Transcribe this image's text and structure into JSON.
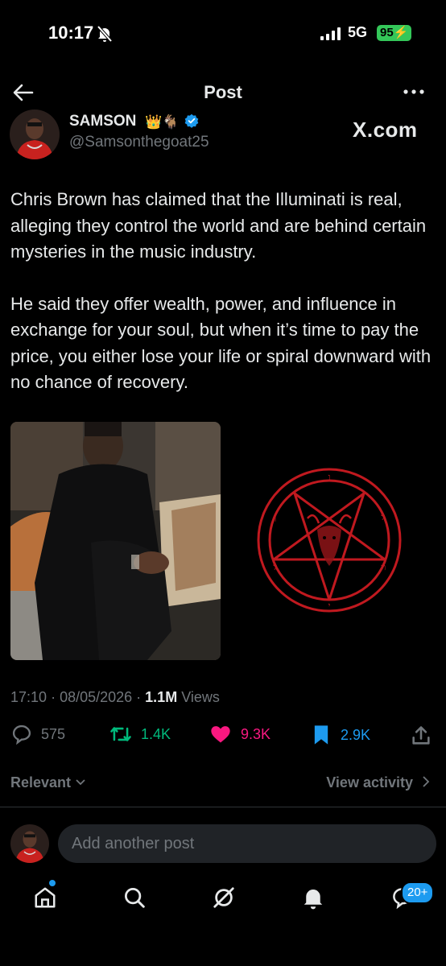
{
  "status": {
    "time": "10:17",
    "network": "5G",
    "battery": "95"
  },
  "header": {
    "title": "Post"
  },
  "author": {
    "name": "SAMSON",
    "badges": "👑🐐",
    "handle": "@Samsonthegoat25"
  },
  "watermark": "X.com",
  "post": {
    "paragraphs": [
      "Chris Brown has claimed that the Illuminati is real, alleging they control the world and are behind certain mysteries in the music industry.",
      "He said they offer wealth, power, and influence in exchange for your soul, but when it’s time to pay the price, you either lose your life or spiral downward with no chance of recovery."
    ],
    "time": "17:10",
    "date": "08/05/2026",
    "views_count": "1.1M",
    "views_label": "Views"
  },
  "actions": {
    "replies": "575",
    "reposts": "1.4K",
    "likes": "9.3K",
    "bookmarks": "2.9K"
  },
  "replies_bar": {
    "filter": "Relevant",
    "view_activity": "View activity"
  },
  "reply_box": {
    "placeholder": "Add another post"
  },
  "bottom_nav": {
    "messages_badge": "20+"
  },
  "colors": {
    "accent": "#1d9bf0",
    "repost": "#00ba7c",
    "like": "#f91880",
    "muted": "#71767b",
    "sigil": "#c0191f"
  },
  "icons": [
    "bell-slash-icon",
    "signal-icon",
    "back-arrow-icon",
    "more-icon",
    "verified-icon",
    "reply-icon",
    "repost-icon",
    "heart-icon",
    "bookmark-icon",
    "share-icon",
    "chevron-down-icon",
    "chevron-right-icon",
    "home-icon",
    "search-icon",
    "grok-icon",
    "notifications-icon",
    "messages-icon"
  ]
}
